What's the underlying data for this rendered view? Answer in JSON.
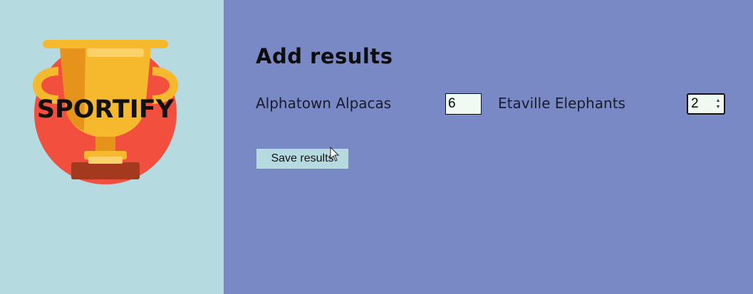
{
  "brand": {
    "name": "SPORTIFY",
    "logo_icon": "trophy-icon",
    "colors": {
      "circle": "#f24f3e",
      "trophy": "#f6b92e",
      "trophy_dark": "#e6931c",
      "base": "#a33a1d"
    }
  },
  "form": {
    "title": "Add results",
    "team_a": {
      "name": "Alphatown Alpacas",
      "score": "6"
    },
    "team_b": {
      "name": "Etaville Elephants",
      "score": "2"
    },
    "save_label": "Save results"
  },
  "colors": {
    "sidebar_bg": "#b5dbe1",
    "main_bg": "#7889c5",
    "button_bg": "#b5dbe1",
    "input_bg": "#eefaf2"
  }
}
